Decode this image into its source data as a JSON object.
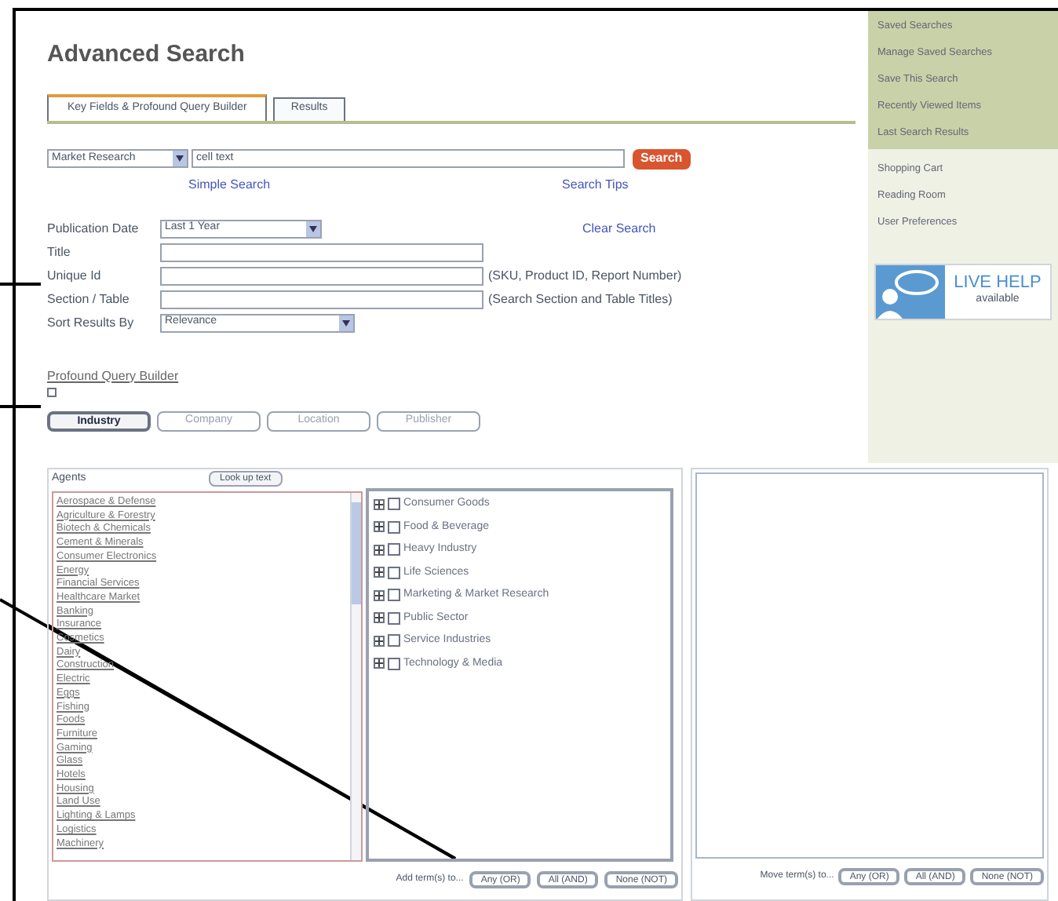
{
  "title": "Advanced Search",
  "tabs": [
    {
      "label": "Key Fields & Profound Query Builder",
      "selected": true
    },
    {
      "label": "Results",
      "selected": false
    }
  ],
  "search": {
    "collection": "Market Research",
    "value": "cell text",
    "button": "Search",
    "simple_link": "Simple Search",
    "tips_link": "Search Tips"
  },
  "publication_date": {
    "label": "Publication Date",
    "value": "Last 1 Year",
    "clear_link": "Clear Search"
  },
  "fields": [
    {
      "label": "Title"
    },
    {
      "label": "Unique Id",
      "hint": "(SKU, Product ID, Report Number)"
    },
    {
      "label": "Section / Table",
      "hint": "(Search Section and Table Titles)"
    }
  ],
  "sort": {
    "label": "Sort Results By",
    "value": "Relevance"
  },
  "query_builder_link": "Profound Query Builder",
  "builder_tabs": [
    {
      "label": "Industry",
      "selected": true
    },
    {
      "label": "Company",
      "selected": false
    },
    {
      "label": "Location",
      "selected": false
    },
    {
      "label": "Publisher",
      "selected": false
    }
  ],
  "lookup": {
    "value": "Agents",
    "button": "Look up text"
  },
  "terms": [
    "Aerospace & Defense",
    "Agriculture & Forestry",
    "Biotech & Chemicals",
    "Cement & Minerals",
    "Consumer Electronics",
    "Energy",
    "Financial Services",
    "Healthcare Market",
    "Banking",
    "Insurance",
    "Cosmetics",
    "Dairy",
    "Construction",
    "Electric",
    "Eggs",
    "Fishing",
    "Foods",
    "Furniture",
    "Gaming",
    "Glass",
    "Hotels",
    "Housing",
    "Land Use",
    "Lighting & Lamps",
    "Logistics",
    "Machinery"
  ],
  "tree": [
    {
      "label": "Consumer Goods",
      "expanded": false,
      "checked": false
    },
    {
      "label": "Food & Beverage",
      "expanded": false,
      "checked": false
    },
    {
      "label": "Heavy Industry",
      "expanded": false,
      "checked": false
    },
    {
      "label": "Life Sciences",
      "expanded": false,
      "checked": false
    },
    {
      "label": "Marketing & Market Research",
      "expanded": false,
      "checked": false
    },
    {
      "label": "Public Sector",
      "expanded": false,
      "checked": false
    },
    {
      "label": "Service Industries",
      "expanded": false,
      "checked": false
    },
    {
      "label": "Technology & Media",
      "expanded": false,
      "checked": false
    }
  ],
  "add_bar": {
    "label": "Add term(s) to...",
    "buttons": [
      "Any (OR)",
      "All (AND)",
      "None (NOT)"
    ]
  },
  "move_bar": {
    "label": "Move term(s) to...",
    "buttons": [
      "Any (OR)",
      "All (AND)",
      "None (NOT)"
    ]
  },
  "sidebar": {
    "top_items": [
      "Saved Searches",
      "Manage Saved Searches",
      "Save This Search",
      "Recently Viewed Items",
      "Last Search Results"
    ],
    "items": [
      "Shopping Cart",
      "Reading Room",
      "User Preferences"
    ],
    "live_help": {
      "title": "LIVE HELP",
      "subtitle": "available"
    }
  }
}
